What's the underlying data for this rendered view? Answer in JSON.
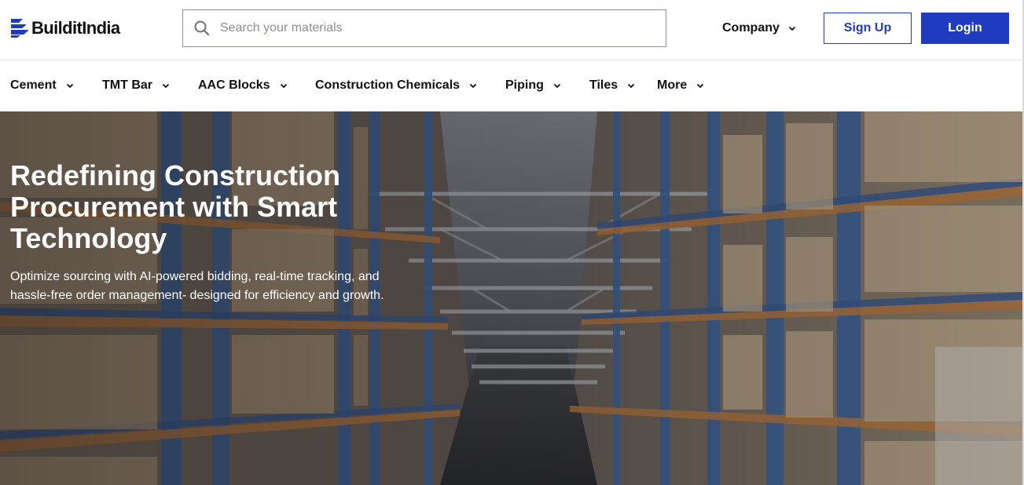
{
  "header": {
    "logo_text": "BuilditIndia",
    "search": {
      "placeholder": "Search your materials",
      "value": ""
    },
    "company_label": "Company",
    "signup_label": "Sign Up",
    "login_label": "Login"
  },
  "categories": [
    {
      "label": "Cement"
    },
    {
      "label": "TMT Bar"
    },
    {
      "label": "AAC Blocks"
    },
    {
      "label": "Construction Chemicals"
    },
    {
      "label": "Piping"
    },
    {
      "label": "Tiles"
    },
    {
      "label": "More"
    }
  ],
  "hero": {
    "title": "Redefining Construction Procurement with Smart Technology",
    "subtitle": "Optimize sourcing with AI-powered bidding, real-time tracking, and hassle-free order management- designed for efficiency and growth."
  },
  "colors": {
    "brand_blue": "#1f3bbf",
    "text_dark": "#111111",
    "hero_text": "#ffffff"
  },
  "icons": {
    "logo": "builditindia-logo-mark",
    "search": "search-icon",
    "dropdown": "chevron-down-icon"
  }
}
